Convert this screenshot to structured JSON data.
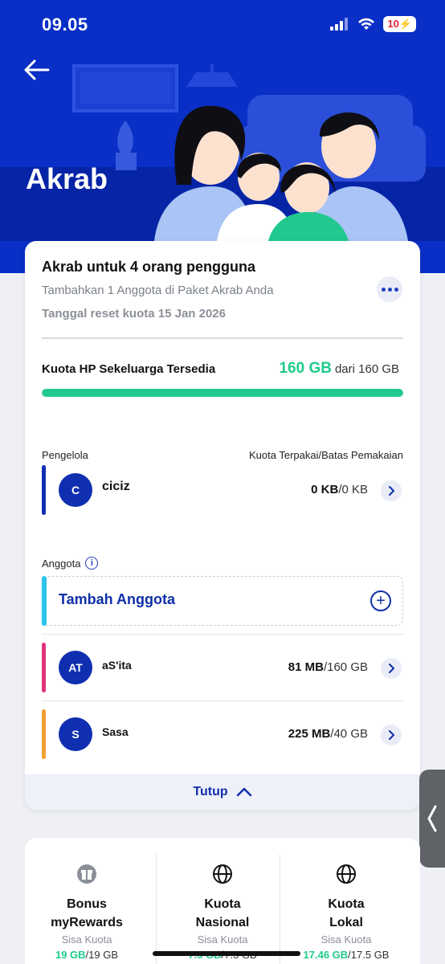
{
  "status_bar": {
    "time": "09.05",
    "battery": "10"
  },
  "header": {
    "title": "Akrab"
  },
  "plan": {
    "title": "Akrab untuk 4 orang pengguna",
    "subtitle": "Tambahkan 1 Anggota di Paket Akrab Anda",
    "reset": "Tanggal reset kuota 15 Jan 2026"
  },
  "quota": {
    "label": "Kuota HP Sekeluarga Tersedia",
    "available": "160 GB",
    "total": "dari 160 GB",
    "fraction": 1.0
  },
  "manager": {
    "section_label": "Pengelola",
    "usage_header": "Kuota Terpakai/Batas Pemakaian",
    "initial": "C",
    "name": "ciciz",
    "used": "0 KB",
    "limit": "/0 KB"
  },
  "members": {
    "section_label": "Anggota",
    "add_label": "Tambah Anggota",
    "items": [
      {
        "initial": "AT",
        "name": "aS'ita",
        "used": "81 MB",
        "limit": "/160 GB"
      },
      {
        "initial": "S",
        "name": "Sasa",
        "used": "225 MB",
        "limit": "/40 GB"
      }
    ]
  },
  "close_label": "Tutup",
  "colors": {
    "primary": "#0a2fc7",
    "green": "#1fcb8a",
    "manager_bar": "#0f2fb0",
    "add_bar": "#2cc4e8",
    "member1_bar": "#e0357a",
    "member2_bar": "#f0a033"
  },
  "bottom": {
    "items": [
      {
        "icon": "gift-icon",
        "name_line1": "Bonus",
        "name_line2": "myRewards",
        "sisa": "Sisa Kuota",
        "value": "19 GB",
        "total": "/19 GB"
      },
      {
        "icon": "globe-icon",
        "name_line1": "Kuota",
        "name_line2": "Nasional",
        "sisa": "Sisa Kuota",
        "value": "7.5 GB",
        "total": "/7.5 GB"
      },
      {
        "icon": "globe-icon",
        "name_line1": "Kuota",
        "name_line2": "Lokal",
        "sisa": "Sisa Kuota",
        "value": "17.46 GB",
        "total": "/17.5 GB"
      }
    ]
  }
}
